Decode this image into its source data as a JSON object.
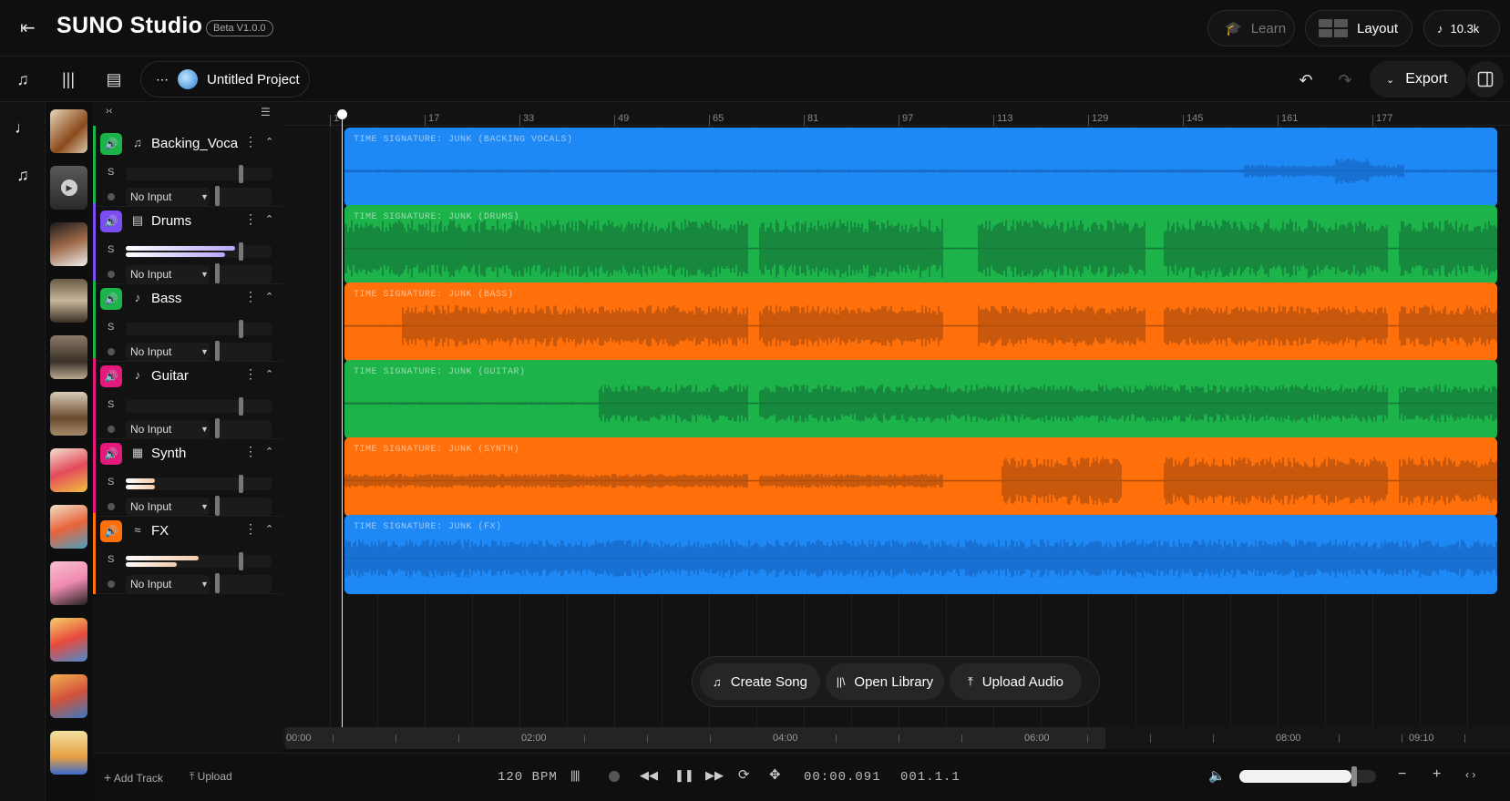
{
  "app": {
    "brand": "SUNO Studio",
    "beta": "Beta V1.0.0",
    "learn": "Learn",
    "layout": "Layout",
    "credits": "10.3k",
    "project": "Untitled Project",
    "export": "Export"
  },
  "colors": {
    "blue": "#1E88F5",
    "green": "#1CB34A",
    "orange": "#FF6F0A",
    "pink": "#E3197B",
    "purple": "#7B4DF2"
  },
  "tracks": [
    {
      "name": "Backing_Vocals",
      "icon": "microphone-icon",
      "input": "No Input",
      "solo": "S",
      "mute_color": "#1CB34A",
      "stripe": "#1CB34A"
    },
    {
      "name": "Drums",
      "icon": "drum-icon",
      "input": "No Input",
      "solo": "S",
      "mute_color": "#7B4DF2",
      "stripe": "#7B4DF2"
    },
    {
      "name": "Bass",
      "icon": "bass-guitar-icon",
      "input": "No Input",
      "solo": "S",
      "mute_color": "#1CB34A",
      "stripe": "#1CB34A"
    },
    {
      "name": "Guitar",
      "icon": "guitar-icon",
      "input": "No Input",
      "solo": "S",
      "mute_color": "#E3197B",
      "stripe": "#E3197B"
    },
    {
      "name": "Synth",
      "icon": "keyboard-icon",
      "input": "No Input",
      "solo": "S",
      "mute_color": "#E3197B",
      "stripe": "#E3197B"
    },
    {
      "name": "FX",
      "icon": "signal-icon",
      "input": "No Input",
      "solo": "S",
      "mute_color": "#FF6F0A",
      "stripe": "#FF6F0A"
    }
  ],
  "clips": [
    {
      "label": "TIME SIGNATURE: JUNK (BACKING VOCALS)",
      "color": "#1E88F5",
      "wave": "#1766C4"
    },
    {
      "label": "TIME SIGNATURE: JUNK (DRUMS)",
      "color": "#1CB34A",
      "wave": "#16773A"
    },
    {
      "label": "TIME SIGNATURE: JUNK (BASS)",
      "color": "#FF6F0A",
      "wave": "#B04F0E"
    },
    {
      "label": "TIME SIGNATURE: JUNK (GUITAR)",
      "color": "#1CB34A",
      "wave": "#16773A"
    },
    {
      "label": "TIME SIGNATURE: JUNK (SYNTH)",
      "color": "#FF6F0A",
      "wave": "#B04F0E"
    },
    {
      "label": "TIME SIGNATURE: JUNK (FX)",
      "color": "#1E88F5",
      "wave": "#1766C4"
    }
  ],
  "ruler": {
    "bars": [
      "1",
      "17",
      "33",
      "49",
      "65",
      "81",
      "97",
      "113",
      "129",
      "145",
      "161",
      "177"
    ]
  },
  "overview": {
    "labels": [
      "00:00",
      "02:00",
      "04:00",
      "06:00",
      "08:00",
      "09:10"
    ]
  },
  "actions": {
    "create_song": "Create Song",
    "open_library": "Open Library",
    "upload_audio": "Upload Audio"
  },
  "transport": {
    "add_track": "Add Track",
    "upload": "Upload",
    "bpm": "120 BPM",
    "time": "00:00.091",
    "position": "001.1.1"
  }
}
